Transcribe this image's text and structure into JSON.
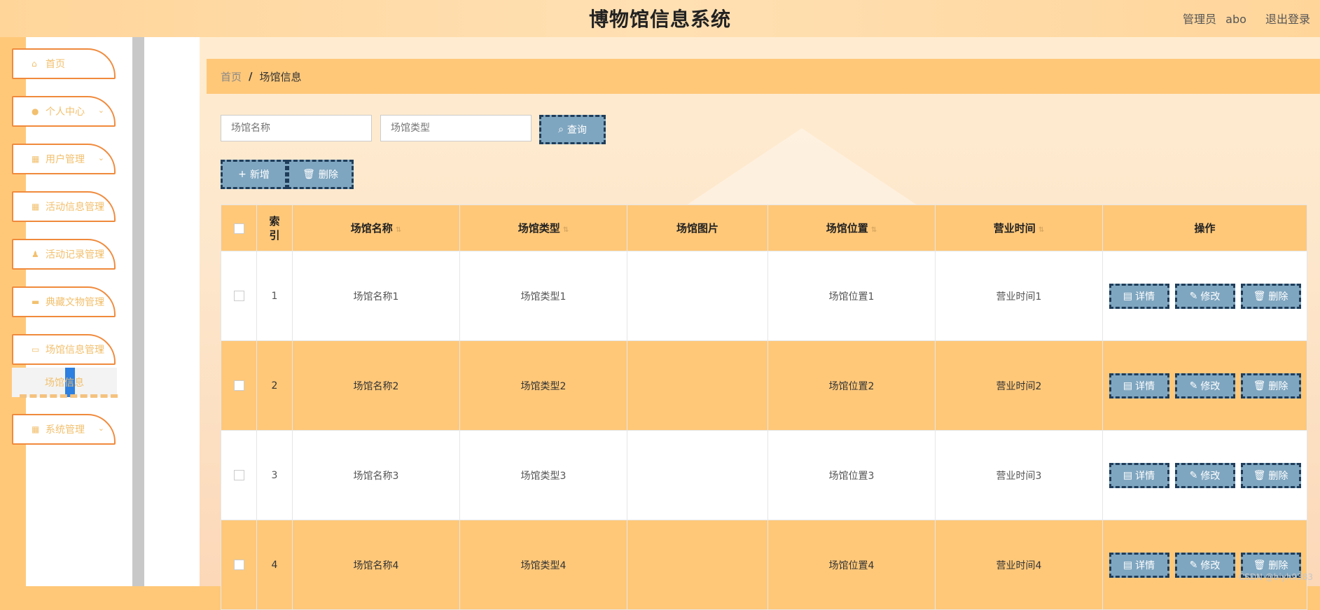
{
  "header": {
    "title": "博物馆信息系统",
    "role": "管理员",
    "username": "abo",
    "logout": "退出登录"
  },
  "sidebar": {
    "items": [
      {
        "label": "首页",
        "icon": "home-icon"
      },
      {
        "label": "个人中心",
        "icon": "user-icon"
      },
      {
        "label": "用户管理",
        "icon": "grid-icon"
      },
      {
        "label": "活动信息管理",
        "icon": "grid-icon"
      },
      {
        "label": "活动记录管理",
        "icon": "person-icon"
      },
      {
        "label": "典藏文物管理",
        "icon": "briefcase-icon"
      },
      {
        "label": "场馆信息管理",
        "icon": "monitor-icon"
      },
      {
        "label": "系统管理",
        "icon": "grid-icon"
      }
    ],
    "active_sub": "场馆信息"
  },
  "breadcrumb": {
    "home": "首页",
    "sep": "/",
    "current": "场馆信息"
  },
  "search": {
    "name_placeholder": "场馆名称",
    "type_placeholder": "场馆类型",
    "query": "查询"
  },
  "actions": {
    "add": "新增",
    "delete": "删除"
  },
  "table": {
    "headers": [
      "索引",
      "场馆名称",
      "场馆类型",
      "场馆图片",
      "场馆位置",
      "营业时间",
      "操作"
    ],
    "rows": [
      {
        "index": "1",
        "name": "场馆名称1",
        "type": "场馆类型1",
        "location": "场馆位置1",
        "hours": "营业时间1"
      },
      {
        "index": "2",
        "name": "场馆名称2",
        "type": "场馆类型2",
        "location": "场馆位置2",
        "hours": "营业时间2"
      },
      {
        "index": "3",
        "name": "场馆名称3",
        "type": "场馆类型3",
        "location": "场馆位置3",
        "hours": "营业时间3"
      },
      {
        "index": "4",
        "name": "场馆名称4",
        "type": "场馆类型4",
        "location": "场馆位置4",
        "hours": "营业时间4"
      }
    ],
    "ops": {
      "detail": "详情",
      "edit": "修改",
      "delete": "删除"
    }
  },
  "watermark": "CSDN @biyh9383",
  "colors": {
    "accent": "#ffc879",
    "button": "#7fa6c0",
    "button_border": "#1f3d5a",
    "menu_border": "#f08a3c"
  }
}
